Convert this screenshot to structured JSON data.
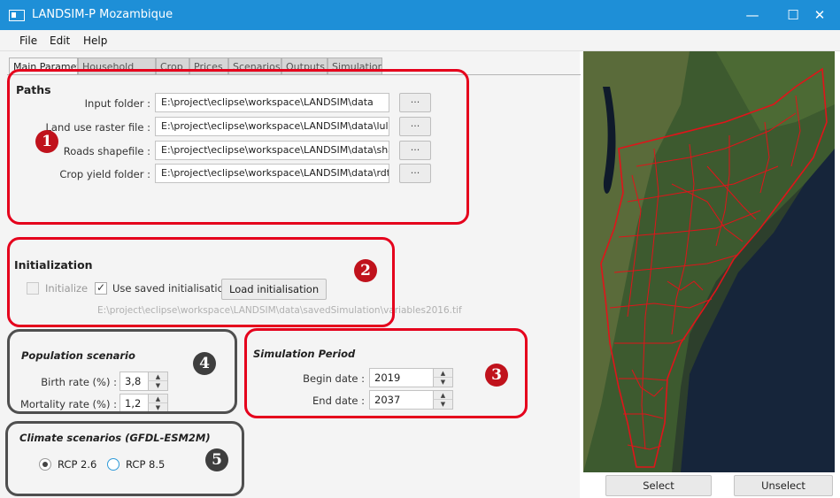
{
  "window": {
    "title": "LANDSIM-P Mozambique",
    "controls": {
      "minimize": "—",
      "maximize": "☐",
      "close": "✕"
    }
  },
  "menu": [
    "File",
    "Edit",
    "Help"
  ],
  "tabs": [
    "Main Parameters",
    "Household",
    "Crop",
    "Prices",
    "Scenarios",
    "Outputs",
    "Simulation"
  ],
  "paths": {
    "title": "Paths",
    "rows": [
      {
        "label": "Input folder :",
        "value": "E:\\project\\eclipse\\workspace\\LANDSIM\\data",
        "button": "..."
      },
      {
        "label": "Land use raster file :",
        "value": "E:\\project\\eclipse\\workspace\\LANDSIM\\data\\lulc\\",
        "button": "..."
      },
      {
        "label": "Roads shapefile :",
        "value": "E:\\project\\eclipse\\workspace\\LANDSIM\\data\\shap",
        "button": "..."
      },
      {
        "label": "Crop yield folder :",
        "value": "E:\\project\\eclipse\\workspace\\LANDSIM\\data\\rdt",
        "button": "..."
      }
    ]
  },
  "initialization": {
    "title": "Initialization",
    "initialize_label": "Initialize",
    "initialize_checked": false,
    "use_saved_label": "Use saved initialisation",
    "use_saved_checked": true,
    "load_button": "Load initialisation",
    "saved_path": "E:\\project\\eclipse\\workspace\\LANDSIM\\data\\savedSimulation\\variables2016.tif"
  },
  "population": {
    "title": "Population scenario",
    "birth_label": "Birth rate (%) :",
    "birth_value": "3,8",
    "mortality_label": "Mortality rate (%) :",
    "mortality_value": "1,2"
  },
  "simulation_period": {
    "title": "Simulation Period",
    "begin_label": "Begin date :",
    "begin_value": "2019",
    "end_label": "End date :",
    "end_value": "2037"
  },
  "climate": {
    "title": "Climate scenarios (GFDL-ESM2M)",
    "options": [
      {
        "label": "RCP 2.6",
        "selected": true
      },
      {
        "label": "RCP 8.5",
        "selected": false
      }
    ]
  },
  "map": {
    "select_button": "Select",
    "unselect_button": "Unselect"
  },
  "annotations": {
    "n1": "1",
    "n2": "2",
    "n3": "3",
    "n4": "4",
    "n5": "5"
  },
  "colors": {
    "titlebar": "#1e8fd7",
    "annotation_red": "#e5001c",
    "annotation_gray": "#4f4f4f",
    "district_lines": "#e0141a"
  },
  "icons": {
    "app": "window-app-icon",
    "spinner_up": "▲",
    "spinner_down": "▼"
  }
}
